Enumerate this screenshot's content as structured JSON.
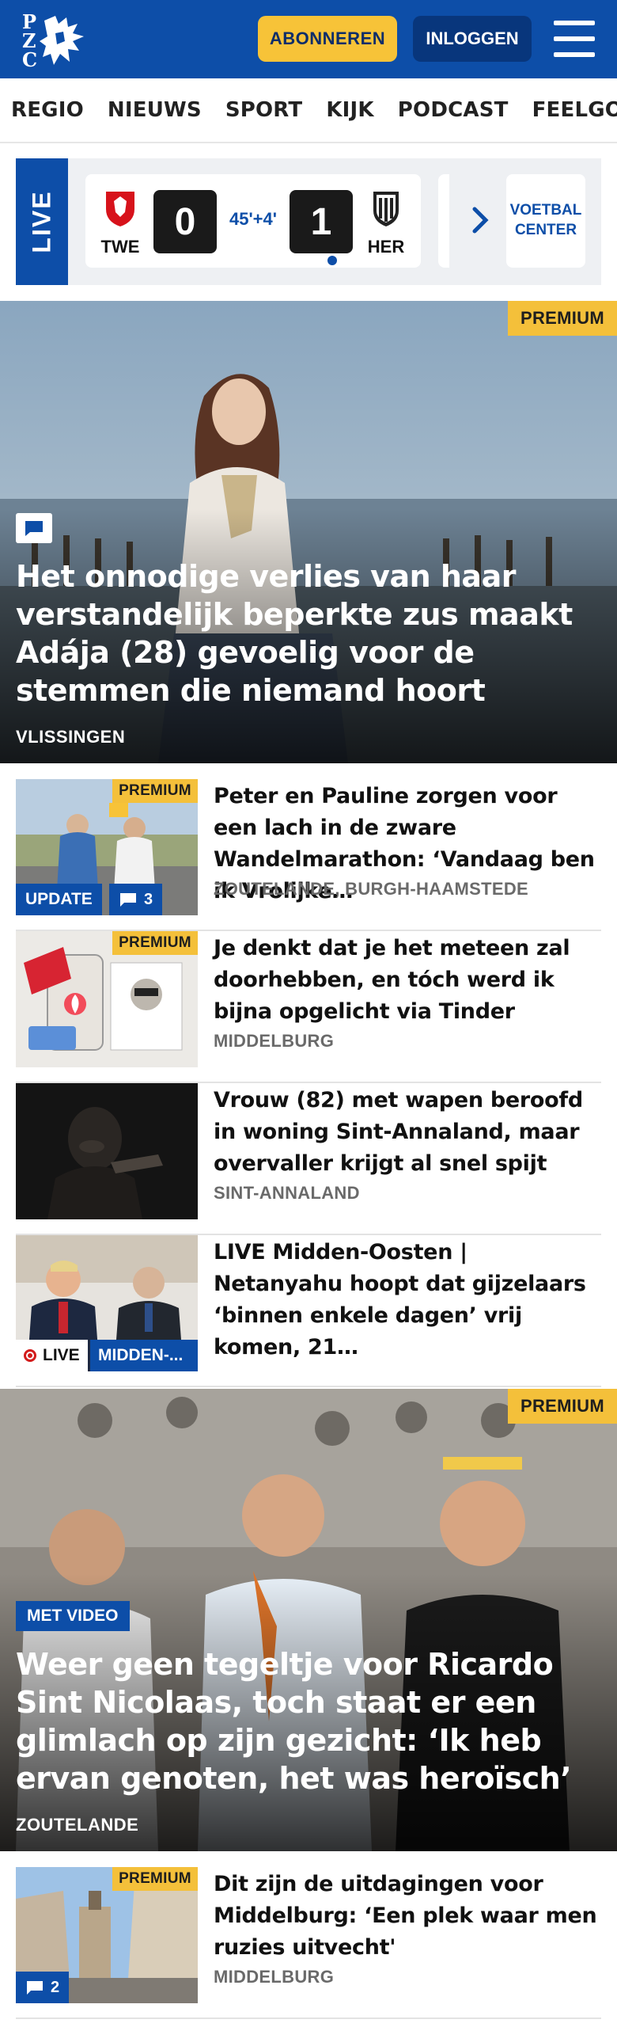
{
  "header": {
    "logo_text": "PZC",
    "subscribe_label": "ABONNEREN",
    "login_label": "INLOGGEN",
    "brand_color": "#0d4ea8",
    "accent_color": "#f7c338"
  },
  "nav": {
    "items": [
      "REGIO",
      "NIEUWS",
      "SPORT",
      "KIJK",
      "PODCAST",
      "FEELGOOD"
    ]
  },
  "live_bar": {
    "label": "LIVE",
    "home_team": "TWE",
    "away_team": "HER",
    "home_score": "0",
    "away_score": "1",
    "match_time": "45'+4'",
    "center_label": "VOETBAL CENTER"
  },
  "hero1": {
    "premium_label": "PREMIUM",
    "title": "Het onnodige verlies van haar verstandelijk beperkte zus maakt Adája (28) gevoelig voor de stemmen die niemand hoort",
    "location": "VLISSINGEN"
  },
  "articles": [
    {
      "premium_label": "PREMIUM",
      "title": "Peter en Pauline zorgen voor een lach in de zware Wandelmara­thon: ‘Vandaag ben ik Vrolijke…",
      "location": "ZOUTELANDE, BURGH-HAAMSTEDE",
      "update_label": "UPDATE",
      "comments": "3"
    },
    {
      "premium_label": "PREMIUM",
      "title": "Je denkt dat je het meteen zal doorhebben, en tóch werd ik bijna opgelicht via Tinder",
      "location": "MIDDELBURG"
    },
    {
      "title": "Vrouw (82) met wapen beroofd in woning Sint-Annaland, maar overvaller krijgt al snel spijt",
      "location": "SINT-ANNALAND"
    },
    {
      "title": "LIVE Midden-Oosten | Netanyahu hoopt dat gijzelaars ‘binnen enkele dagen’ vrij komen, 21…",
      "live_label": "LIVE",
      "topic_label": "MIDDEN-..."
    }
  ],
  "hero2": {
    "premium_label": "PREMIUM",
    "video_label": "MET VIDEO",
    "title": "Weer geen tegeltje voor Ricardo Sint Nicolaas, toch staat er een glimlach op zijn gezicht: ‘Ik heb ervan genoten, het was heroïsch’",
    "location": "ZOUTELANDE"
  },
  "article5": {
    "premium_label": "PREMIUM",
    "title": "Dit zijn de uitdagingen voor Middelburg: ‘Een plek waar men ruzies uitvecht'",
    "location": "MIDDELBURG",
    "comments": "2"
  }
}
